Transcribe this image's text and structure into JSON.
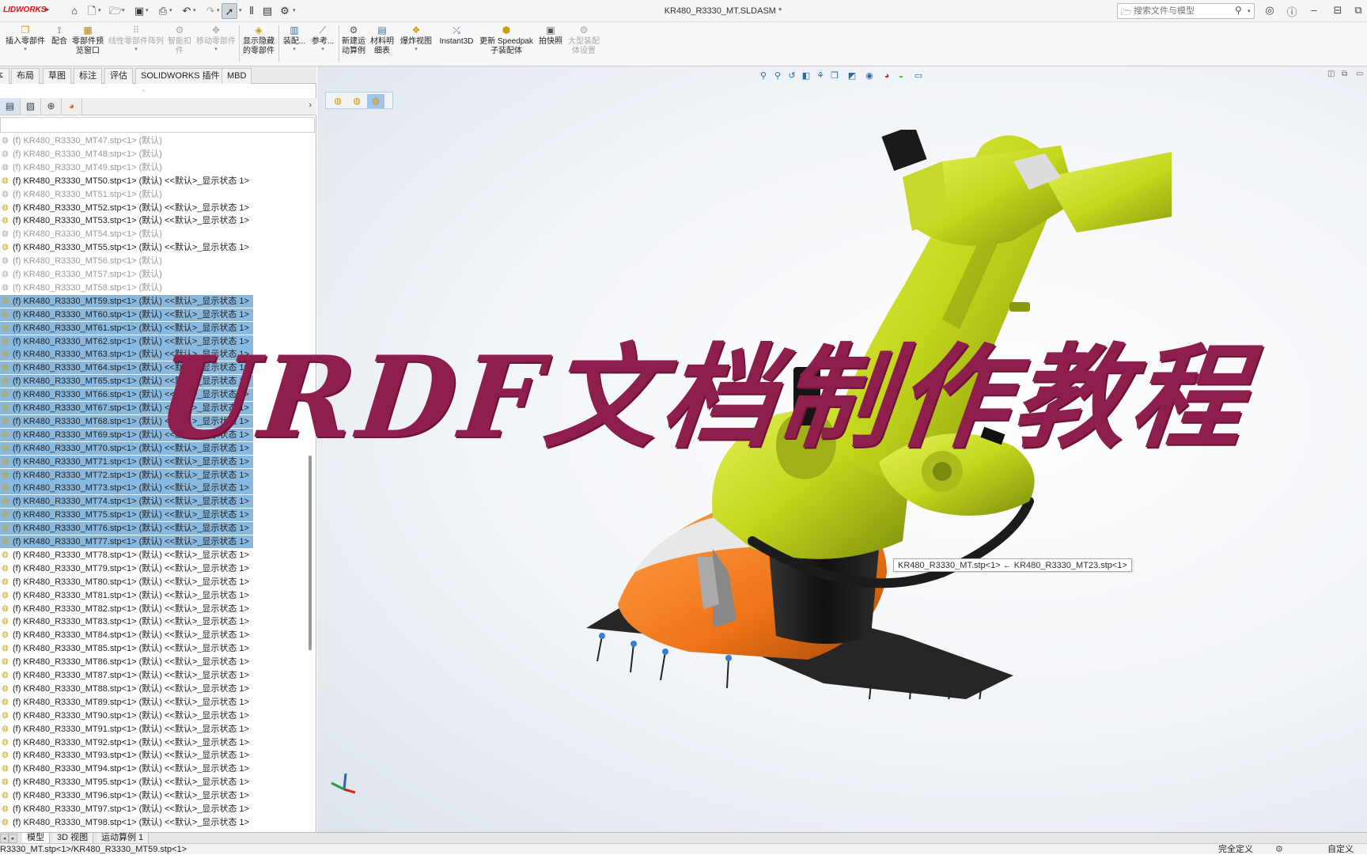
{
  "brand": "LIDWORKS",
  "document_title": "KR480_R3330_MT.SLDASM *",
  "search": {
    "placeholder": "搜索文件与模型"
  },
  "ribbon": [
    {
      "label": "插入零部件",
      "icon": "insert-component-icon"
    },
    {
      "label": "配合",
      "icon": "mate-icon"
    },
    {
      "label": "零部件预\n览窗口",
      "icon": "component-preview-icon"
    },
    {
      "label": "线性零部件阵列",
      "icon": "linear-pattern-icon",
      "disabled": true
    },
    {
      "label": "智能扣\n件",
      "icon": "smart-fastener-icon",
      "disabled": true
    },
    {
      "label": "移动零部件",
      "icon": "move-component-icon",
      "disabled": true
    },
    {
      "label": "显示隐藏\n的零部件",
      "icon": "show-hidden-icon"
    },
    {
      "label": "装配...",
      "icon": "assembly-features-icon"
    },
    {
      "label": "参考...",
      "icon": "reference-geometry-icon"
    },
    {
      "label": "新建运\n动算例",
      "icon": "new-motion-study-icon"
    },
    {
      "label": "材料明\n细表",
      "icon": "bom-icon"
    },
    {
      "label": "爆炸视图",
      "icon": "exploded-view-icon"
    },
    {
      "label": "Instant3D",
      "icon": "instant3d-icon"
    },
    {
      "label": "更新 Speedpak\n子装配体",
      "icon": "speedpak-icon"
    },
    {
      "label": "拍快照",
      "icon": "snapshot-icon"
    },
    {
      "label": "大型装配\n体设置",
      "icon": "large-assembly-icon",
      "disabled": true
    }
  ],
  "tabs": [
    "本",
    "布局",
    "草图",
    "标注",
    "评估",
    "SOLIDWORKS 插件",
    "MBD"
  ],
  "tree": [
    {
      "text": "(f) KR480_R3330_MT47.stp<1> (默认)",
      "state": "suppressed"
    },
    {
      "text": "(f) KR480_R3330_MT48.stp<1> (默认)",
      "state": "suppressed"
    },
    {
      "text": "(f) KR480_R3330_MT49.stp<1> (默认)",
      "state": "suppressed"
    },
    {
      "text": "(f) KR480_R3330_MT50.stp<1> (默认) <<默认>_显示状态 1>",
      "state": "normal"
    },
    {
      "text": "(f) KR480_R3330_MT51.stp<1> (默认)",
      "state": "suppressed"
    },
    {
      "text": "(f) KR480_R3330_MT52.stp<1> (默认) <<默认>_显示状态 1>",
      "state": "normal"
    },
    {
      "text": "(f) KR480_R3330_MT53.stp<1> (默认) <<默认>_显示状态 1>",
      "state": "normal"
    },
    {
      "text": "(f) KR480_R3330_MT54.stp<1> (默认)",
      "state": "suppressed"
    },
    {
      "text": "(f) KR480_R3330_MT55.stp<1> (默认) <<默认>_显示状态 1>",
      "state": "normal"
    },
    {
      "text": "(f) KR480_R3330_MT56.stp<1> (默认)",
      "state": "suppressed"
    },
    {
      "text": "(f) KR480_R3330_MT57.stp<1> (默认)",
      "state": "suppressed"
    },
    {
      "text": "(f) KR480_R3330_MT58.stp<1> (默认)",
      "state": "suppressed"
    },
    {
      "text": "(f) KR480_R3330_MT59.stp<1> (默认) <<默认>_显示状态 1>",
      "state": "selected"
    },
    {
      "text": "(f) KR480_R3330_MT60.stp<1> (默认) <<默认>_显示状态 1>",
      "state": "selected"
    },
    {
      "text": "(f) KR480_R3330_MT61.stp<1> (默认) <<默认>_显示状态 1>",
      "state": "selected"
    },
    {
      "text": "(f) KR480_R3330_MT62.stp<1> (默认) <<默认>_显示状态 1>",
      "state": "selected"
    },
    {
      "text": "(f) KR480_R3330_MT63.stp<1> (默认) <<默认>_显示状态 1>",
      "state": "selected"
    },
    {
      "text": "(f) KR480_R3330_MT64.stp<1> (默认) <<默认>_显示状态 1>",
      "state": "selected"
    },
    {
      "text": "(f) KR480_R3330_MT65.stp<1> (默认) <<默认>_显示状态 1>",
      "state": "selected"
    },
    {
      "text": "(f) KR480_R3330_MT66.stp<1> (默认) <<默认>_显示状态 1>",
      "state": "selected"
    },
    {
      "text": "(f) KR480_R3330_MT67.stp<1> (默认) <<默认>_显示状态 1>",
      "state": "selected"
    },
    {
      "text": "(f) KR480_R3330_MT68.stp<1> (默认) <<默认>_显示状态 1>",
      "state": "selected"
    },
    {
      "text": "(f) KR480_R3330_MT69.stp<1> (默认) <<默认>_显示状态 1>",
      "state": "selected"
    },
    {
      "text": "(f) KR480_R3330_MT70.stp<1> (默认) <<默认>_显示状态 1>",
      "state": "selected"
    },
    {
      "text": "(f) KR480_R3330_MT71.stp<1> (默认) <<默认>_显示状态 1>",
      "state": "selected"
    },
    {
      "text": "(f) KR480_R3330_MT72.stp<1> (默认) <<默认>_显示状态 1>",
      "state": "selected"
    },
    {
      "text": "(f) KR480_R3330_MT73.stp<1> (默认) <<默认>_显示状态 1>",
      "state": "selected"
    },
    {
      "text": "(f) KR480_R3330_MT74.stp<1> (默认) <<默认>_显示状态 1>",
      "state": "selected"
    },
    {
      "text": "(f) KR480_R3330_MT75.stp<1> (默认) <<默认>_显示状态 1>",
      "state": "selected"
    },
    {
      "text": "(f) KR480_R3330_MT76.stp<1> (默认) <<默认>_显示状态 1>",
      "state": "selected"
    },
    {
      "text": "(f) KR480_R3330_MT77.stp<1> (默认) <<默认>_显示状态 1>",
      "state": "selected"
    },
    {
      "text": "(f) KR480_R3330_MT78.stp<1> (默认) <<默认>_显示状态 1>",
      "state": "normal"
    },
    {
      "text": "(f) KR480_R3330_MT79.stp<1> (默认) <<默认>_显示状态 1>",
      "state": "normal"
    },
    {
      "text": "(f) KR480_R3330_MT80.stp<1> (默认) <<默认>_显示状态 1>",
      "state": "normal"
    },
    {
      "text": "(f) KR480_R3330_MT81.stp<1> (默认) <<默认>_显示状态 1>",
      "state": "normal"
    },
    {
      "text": "(f) KR480_R3330_MT82.stp<1> (默认) <<默认>_显示状态 1>",
      "state": "normal"
    },
    {
      "text": "(f) KR480_R3330_MT83.stp<1> (默认) <<默认>_显示状态 1>",
      "state": "normal"
    },
    {
      "text": "(f) KR480_R3330_MT84.stp<1> (默认) <<默认>_显示状态 1>",
      "state": "normal"
    },
    {
      "text": "(f) KR480_R3330_MT85.stp<1> (默认) <<默认>_显示状态 1>",
      "state": "normal"
    },
    {
      "text": "(f) KR480_R3330_MT86.stp<1> (默认) <<默认>_显示状态 1>",
      "state": "normal"
    },
    {
      "text": "(f) KR480_R3330_MT87.stp<1> (默认) <<默认>_显示状态 1>",
      "state": "normal"
    },
    {
      "text": "(f) KR480_R3330_MT88.stp<1> (默认) <<默认>_显示状态 1>",
      "state": "normal"
    },
    {
      "text": "(f) KR480_R3330_MT89.stp<1> (默认) <<默认>_显示状态 1>",
      "state": "normal"
    },
    {
      "text": "(f) KR480_R3330_MT90.stp<1> (默认) <<默认>_显示状态 1>",
      "state": "normal"
    },
    {
      "text": "(f) KR480_R3330_MT91.stp<1> (默认) <<默认>_显示状态 1>",
      "state": "normal"
    },
    {
      "text": "(f) KR480_R3330_MT92.stp<1> (默认) <<默认>_显示状态 1>",
      "state": "normal"
    },
    {
      "text": "(f) KR480_R3330_MT93.stp<1> (默认) <<默认>_显示状态 1>",
      "state": "normal"
    },
    {
      "text": "(f) KR480_R3330_MT94.stp<1> (默认) <<默认>_显示状态 1>",
      "state": "normal"
    },
    {
      "text": "(f) KR480_R3330_MT95.stp<1> (默认) <<默认>_显示状态 1>",
      "state": "normal"
    },
    {
      "text": "(f) KR480_R3330_MT96.stp<1> (默认) <<默认>_显示状态 1>",
      "state": "normal"
    },
    {
      "text": "(f) KR480_R3330_MT97.stp<1> (默认) <<默认>_显示状态 1>",
      "state": "normal"
    },
    {
      "text": "(f) KR480_R3330_MT98.stp<1> (默认) <<默认>_显示状态 1>",
      "state": "normal"
    }
  ],
  "tooltip": "KR480_R3330_MT.stp<1> ← KR480_R3330_MT23.stp<1>",
  "overlay_title": "URDF文档制作教程",
  "bottom_tabs": [
    "模型",
    "3D 视图",
    "运动算例 1"
  ],
  "status": {
    "path": "R3330_MT.stp<1>/KR480_R3330_MT59.stp<1>",
    "definition": "完全定义",
    "custom": "自定义"
  },
  "colors": {
    "selection": "#8ab9df",
    "robot_body": "#c7dc1e",
    "robot_base": "#f07a1c",
    "overlay": "#8e1e4c"
  }
}
